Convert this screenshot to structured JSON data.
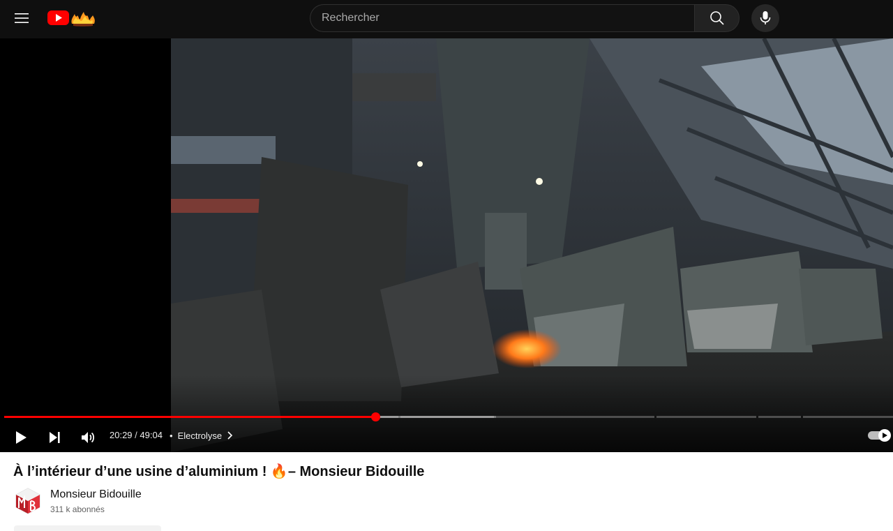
{
  "masthead": {
    "search": {
      "placeholder": "Rechercher",
      "value": ""
    }
  },
  "player": {
    "current_time": "20:29",
    "time_separator": "/",
    "duration": "49:04",
    "chapter_dot": "•",
    "chapter": "Electrolyse",
    "progress_played": 0.4176,
    "progress_buffered": 0.5533,
    "autoplay": true
  },
  "video_info": {
    "title": "À l’intérieur d’une usine d’aluminium ! 🔥– Monsieur Bidouille",
    "channel_name": "Monsieur Bidouille",
    "subscribers": "311 k abonnés"
  },
  "colors": {
    "masthead_bg": "#0f0f0f",
    "accent_red": "#ff0000",
    "text_primary": "#0f0f0f",
    "text_secondary": "#606060"
  }
}
